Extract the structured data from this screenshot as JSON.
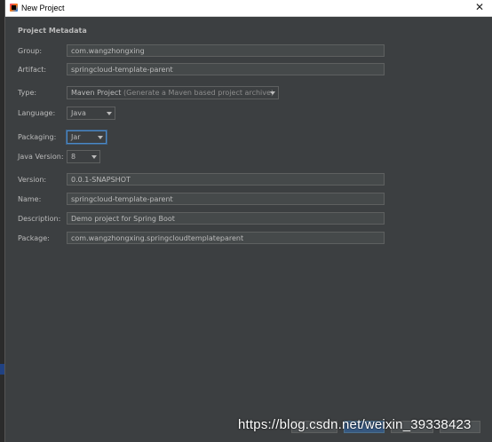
{
  "window": {
    "title": "New Project",
    "close_glyph": "✕"
  },
  "metadata": {
    "section_title": "Project Metadata",
    "group": {
      "label": "Group:",
      "value": "com.wangzhongxing"
    },
    "artifact": {
      "label": "Artifact:",
      "value": "springcloud-template-parent"
    },
    "type": {
      "label": "Type:",
      "value": "Maven Project",
      "hint": "(Generate a Maven based project archive)"
    },
    "language": {
      "label": "Language:",
      "value": "Java"
    },
    "packaging": {
      "label": "Packaging:",
      "value": "Jar"
    },
    "java_version": {
      "label": "Java Version:",
      "value": "8"
    },
    "version": {
      "label": "Version:",
      "value": "0.0.1-SNAPSHOT"
    },
    "name": {
      "label": "Name:",
      "value": "springcloud-template-parent"
    },
    "description": {
      "label": "Description:",
      "value": "Demo project for Spring Boot"
    },
    "package": {
      "label": "Package:",
      "value": "com.wangzhongxing.springcloudtemplateparent"
    }
  },
  "watermark": "https://blog.csdn.net/weixin_39338423",
  "colors": {
    "dialog_bg": "#3c3f41",
    "field_bg": "#45494a",
    "text": "#bbbbbb",
    "focus": "#4a88c7",
    "primary_button": "#365880"
  },
  "icons": {
    "app": "intellij-idea-icon",
    "close": "close-icon",
    "dropdown": "chevron-down-icon"
  }
}
